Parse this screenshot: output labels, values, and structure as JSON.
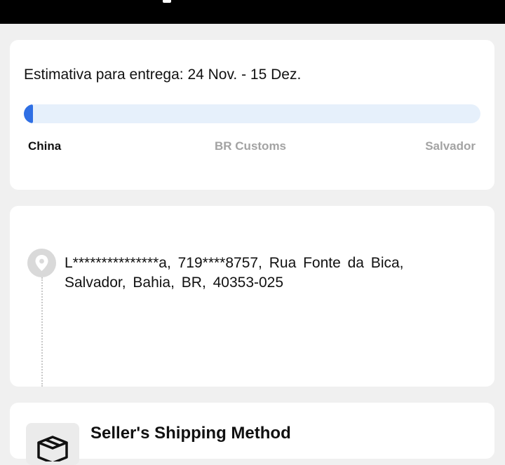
{
  "delivery": {
    "estimate_text": "Estimativa para entrega: 24 Nov. - 15 Dez.",
    "progress_fraction": 0.02,
    "stages": [
      "China",
      "BR Customs",
      "Salvador"
    ],
    "current_stage": "China"
  },
  "address": {
    "icon": "location-pin-icon",
    "text": "L***************a,  719****8757,  Rua Fonte da Bica,  Salvador,  Bahia,  BR,  40353-025"
  },
  "shipping": {
    "icon": "package-box-icon",
    "title": "Seller's Shipping Method"
  },
  "colors": {
    "progress_fill": "#2f6fe4",
    "progress_track": "#e6f0fb",
    "stage_active": "#111111",
    "stage_inactive": "#a3a3a3",
    "topbar": "#000000"
  }
}
